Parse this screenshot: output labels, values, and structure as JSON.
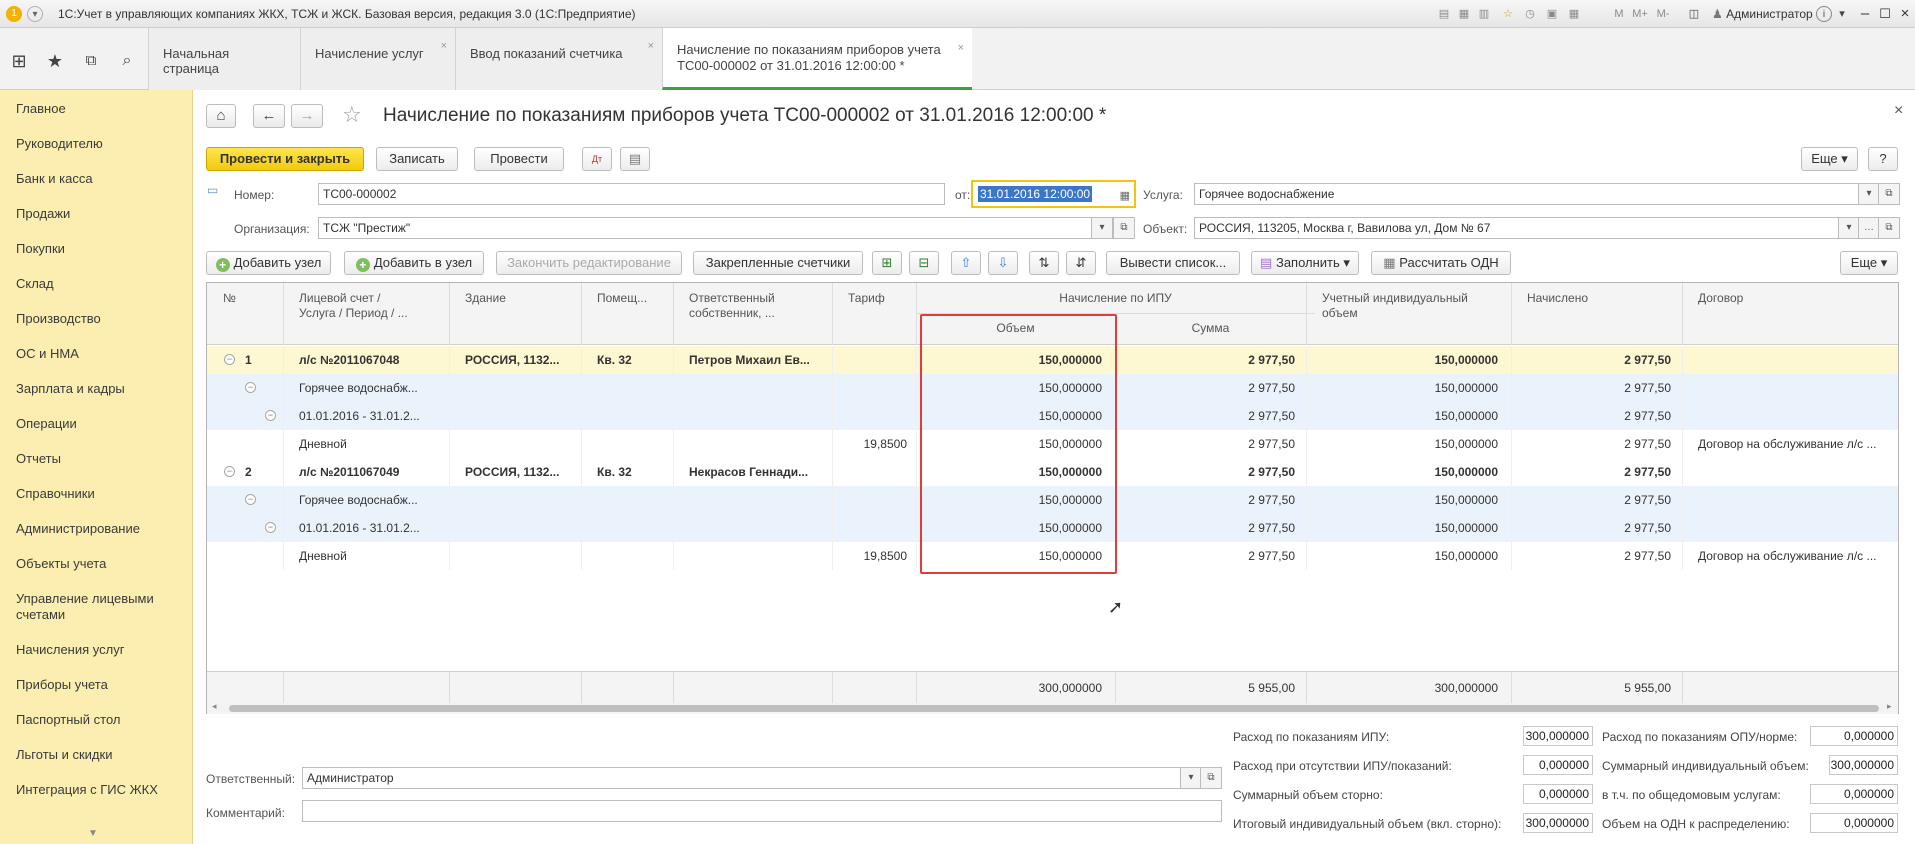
{
  "window": {
    "title": "1С:Учет в управляющих компаниях ЖКХ, ТСЖ и ЖСК. Базовая версия, редакция 3.0  (1С:Предприятие)",
    "user": "Администратор",
    "m_buttons": [
      "M",
      "M+",
      "M-"
    ]
  },
  "tabs": [
    {
      "label": "Начальная страница"
    },
    {
      "label": "Начисление услуг"
    },
    {
      "label": "Ввод показаний счетчика"
    },
    {
      "label_line1": "Начисление по показаниям приборов учета",
      "label_line2": "ТС00-000002 от 31.01.2016 12:00:00 *"
    }
  ],
  "sidebar": {
    "items": [
      "Главное",
      "Руководителю",
      "Банк и касса",
      "Продажи",
      "Покупки",
      "Склад",
      "Производство",
      "ОС и НМА",
      "Зарплата и кадры",
      "Операции",
      "Отчеты",
      "Справочники",
      "Администрирование",
      "Объекты учета",
      "Управление лицевыми счетами",
      "Начисления услуг",
      "Приборы учета",
      "Паспортный стол",
      "Льготы и скидки",
      "Интеграция с ГИС ЖКХ"
    ]
  },
  "document": {
    "title": "Начисление по показаниям приборов учета ТС00-000002 от 31.01.2016 12:00:00 *",
    "toolbar": {
      "post_close": "Провести и закрыть",
      "save": "Записать",
      "post": "Провести",
      "more": "Еще",
      "help": "?"
    },
    "fields": {
      "number_label": "Номер:",
      "number_value": "ТС00-000002",
      "date_label": "от:",
      "date_value": "31.01.2016 12:00:00",
      "service_label": "Услуга:",
      "service_value": "Горячее водоснабжение",
      "org_label": "Организация:",
      "org_value": "ТСЖ \"Престиж\"",
      "object_label": "Объект:",
      "object_value": "РОССИЯ, 113205, Москва г, Вавилова ул, Дом № 67"
    },
    "table_toolbar": {
      "add_node": "Добавить узел",
      "add_to_node": "Добавить в узел",
      "finish_edit": "Закончить редактирование",
      "pinned_counters": "Закрепленные счетчики",
      "show_list": "Вывести список...",
      "fill": "Заполнить",
      "calc_odn": "Рассчитать ОДН",
      "more": "Еще"
    }
  },
  "table": {
    "headers": {
      "num": "№",
      "account_l1": "Лицевой счет /",
      "account_l2": "Услуга / Период / ...",
      "building": "Здание",
      "room": "Помещ...",
      "owner_l1": "Ответственный",
      "owner_l2": "собственник, ...",
      "tariff": "Тариф",
      "ipu_group": "Начисление по ИПУ",
      "volume": "Объем",
      "sum": "Сумма",
      "ind_l1": "Учетный индивидуальный",
      "ind_l2": "объем",
      "charged": "Начислено",
      "contract": "Договор"
    },
    "rows": [
      {
        "num": "1",
        "account": "л/с №2011067048",
        "building": "РОССИЯ, 1132...",
        "room": "Кв. 32",
        "owner": "Петров Михаил Ев...",
        "tariff": "",
        "volume": "150,000000",
        "sum": "2 977,50",
        "ind": "150,000000",
        "charged": "2 977,50",
        "contract": ""
      },
      {
        "num": "",
        "account": "Горячее водоснабж...",
        "building": "",
        "room": "",
        "owner": "",
        "tariff": "",
        "volume": "150,000000",
        "sum": "2 977,50",
        "ind": "150,000000",
        "charged": "2 977,50",
        "contract": ""
      },
      {
        "num": "",
        "account": "01.01.2016 - 31.01.2...",
        "building": "",
        "room": "",
        "owner": "",
        "tariff": "",
        "volume": "150,000000",
        "sum": "2 977,50",
        "ind": "150,000000",
        "charged": "2 977,50",
        "contract": ""
      },
      {
        "num": "",
        "account": "Дневной",
        "building": "",
        "room": "",
        "owner": "",
        "tariff": "19,8500",
        "volume": "150,000000",
        "sum": "2 977,50",
        "ind": "150,000000",
        "charged": "2 977,50",
        "contract": "Договор на обслуживание л/с ..."
      },
      {
        "num": "2",
        "account": "л/с №2011067049",
        "building": "РОССИЯ, 1132...",
        "room": "Кв. 32",
        "owner": "Некрасов Геннади...",
        "tariff": "",
        "volume": "150,000000",
        "sum": "2 977,50",
        "ind": "150,000000",
        "charged": "2 977,50",
        "contract": ""
      },
      {
        "num": "",
        "account": "Горячее водоснабж...",
        "building": "",
        "room": "",
        "owner": "",
        "tariff": "",
        "volume": "150,000000",
        "sum": "2 977,50",
        "ind": "150,000000",
        "charged": "2 977,50",
        "contract": ""
      },
      {
        "num": "",
        "account": "01.01.2016 - 31.01.2...",
        "building": "",
        "room": "",
        "owner": "",
        "tariff": "",
        "volume": "150,000000",
        "sum": "2 977,50",
        "ind": "150,000000",
        "charged": "2 977,50",
        "contract": ""
      },
      {
        "num": "",
        "account": "Дневной",
        "building": "",
        "room": "",
        "owner": "",
        "tariff": "19,8500",
        "volume": "150,000000",
        "sum": "2 977,50",
        "ind": "150,000000",
        "charged": "2 977,50",
        "contract": "Договор на обслуживание л/с ..."
      }
    ],
    "totals": {
      "volume": "300,000000",
      "sum": "5 955,00",
      "ind": "300,000000",
      "charged": "5 955,00"
    }
  },
  "footer": {
    "responsible_label": "Ответственный:",
    "responsible_value": "Администратор",
    "comment_label": "Комментарий:",
    "comment_value": "",
    "summary": {
      "ipu_label": "Расход по показаниям ИПУ:",
      "ipu_value": "300,000000",
      "no_ipu_label": "Расход при отсутствии ИПУ/показаний:",
      "no_ipu_value": "0,000000",
      "storno_label": "Суммарный объем сторно:",
      "storno_value": "0,000000",
      "total_ind_label": "Итоговый индивидуальный объем (вкл. сторно):",
      "total_ind_value": "300,000000",
      "opu_label": "Расход по показаниям ОПУ/норме:",
      "opu_value": "0,000000",
      "sum_ind_label": "Суммарный индивидуальный объем:",
      "sum_ind_value": "300,000000",
      "common_label": "в т.ч. по общедомовым услугам:",
      "common_value": "0,000000",
      "odn_label": "Объем на ОДН к распределению:",
      "odn_value": "0,000000"
    }
  }
}
